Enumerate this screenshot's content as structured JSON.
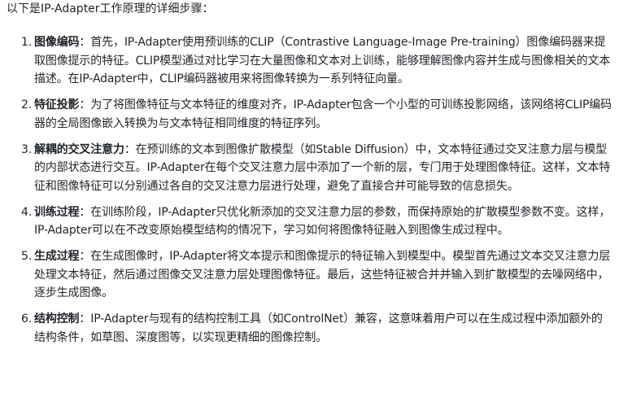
{
  "intro": "以下是IP-Adapter工作原理的详细步骤：",
  "steps": [
    {
      "num": "1.",
      "term": "图像编码",
      "sep": "：",
      "desc": "首先，IP-Adapter使用预训练的CLIP（Contrastive Language-Image Pre-training）图像编码器来提取图像提示的特征。CLIP模型通过对比学习在大量图像和文本对上训练，能够理解图像内容并生成与图像相关的文本描述。在IP-Adapter中，CLIP编码器被用来将图像转换为一系列特征向量。"
    },
    {
      "num": "2.",
      "term": "特征投影",
      "sep": "：",
      "desc": "为了将图像特征与文本特征的维度对齐，IP-Adapter包含一个小型的可训练投影网络，该网络将CLIP编码器的全局图像嵌入转换为与文本特征相同维度的特征序列。"
    },
    {
      "num": "3.",
      "term": "解耦的交叉注意力",
      "sep": "：",
      "desc": "在预训练的文本到图像扩散模型（如Stable Diffusion）中，文本特征通过交叉注意力层与模型的内部状态进行交互。IP-Adapter在每个交叉注意力层中添加了一个新的层，专门用于处理图像特征。这样，文本特征和图像特征可以分别通过各自的交叉注意力层进行处理，避免了直接合并可能导致的信息损失。"
    },
    {
      "num": "4.",
      "term": "训练过程",
      "sep": "：",
      "desc": "在训练阶段，IP-Adapter只优化新添加的交叉注意力层的参数，而保持原始的扩散模型参数不变。这样，IP-Adapter可以在不改变原始模型结构的情况下，学习如何将图像特征融入到图像生成过程中。"
    },
    {
      "num": "5.",
      "term": "生成过程",
      "sep": "：",
      "desc": "在生成图像时，IP-Adapter将文本提示和图像提示的特征输入到模型中。模型首先通过文本交叉注意力层处理文本特征，然后通过图像交叉注意力层处理图像特征。最后，这些特征被合并并输入到扩散模型的去噪网络中，逐步生成图像。"
    },
    {
      "num": "6.",
      "term": "结构控制",
      "sep": "：",
      "desc": "IP-Adapter与现有的结构控制工具（如ControlNet）兼容，这意味着用户可以在生成过程中添加额外的结构条件，如草图、深度图等，以实现更精细的图像控制。"
    }
  ]
}
